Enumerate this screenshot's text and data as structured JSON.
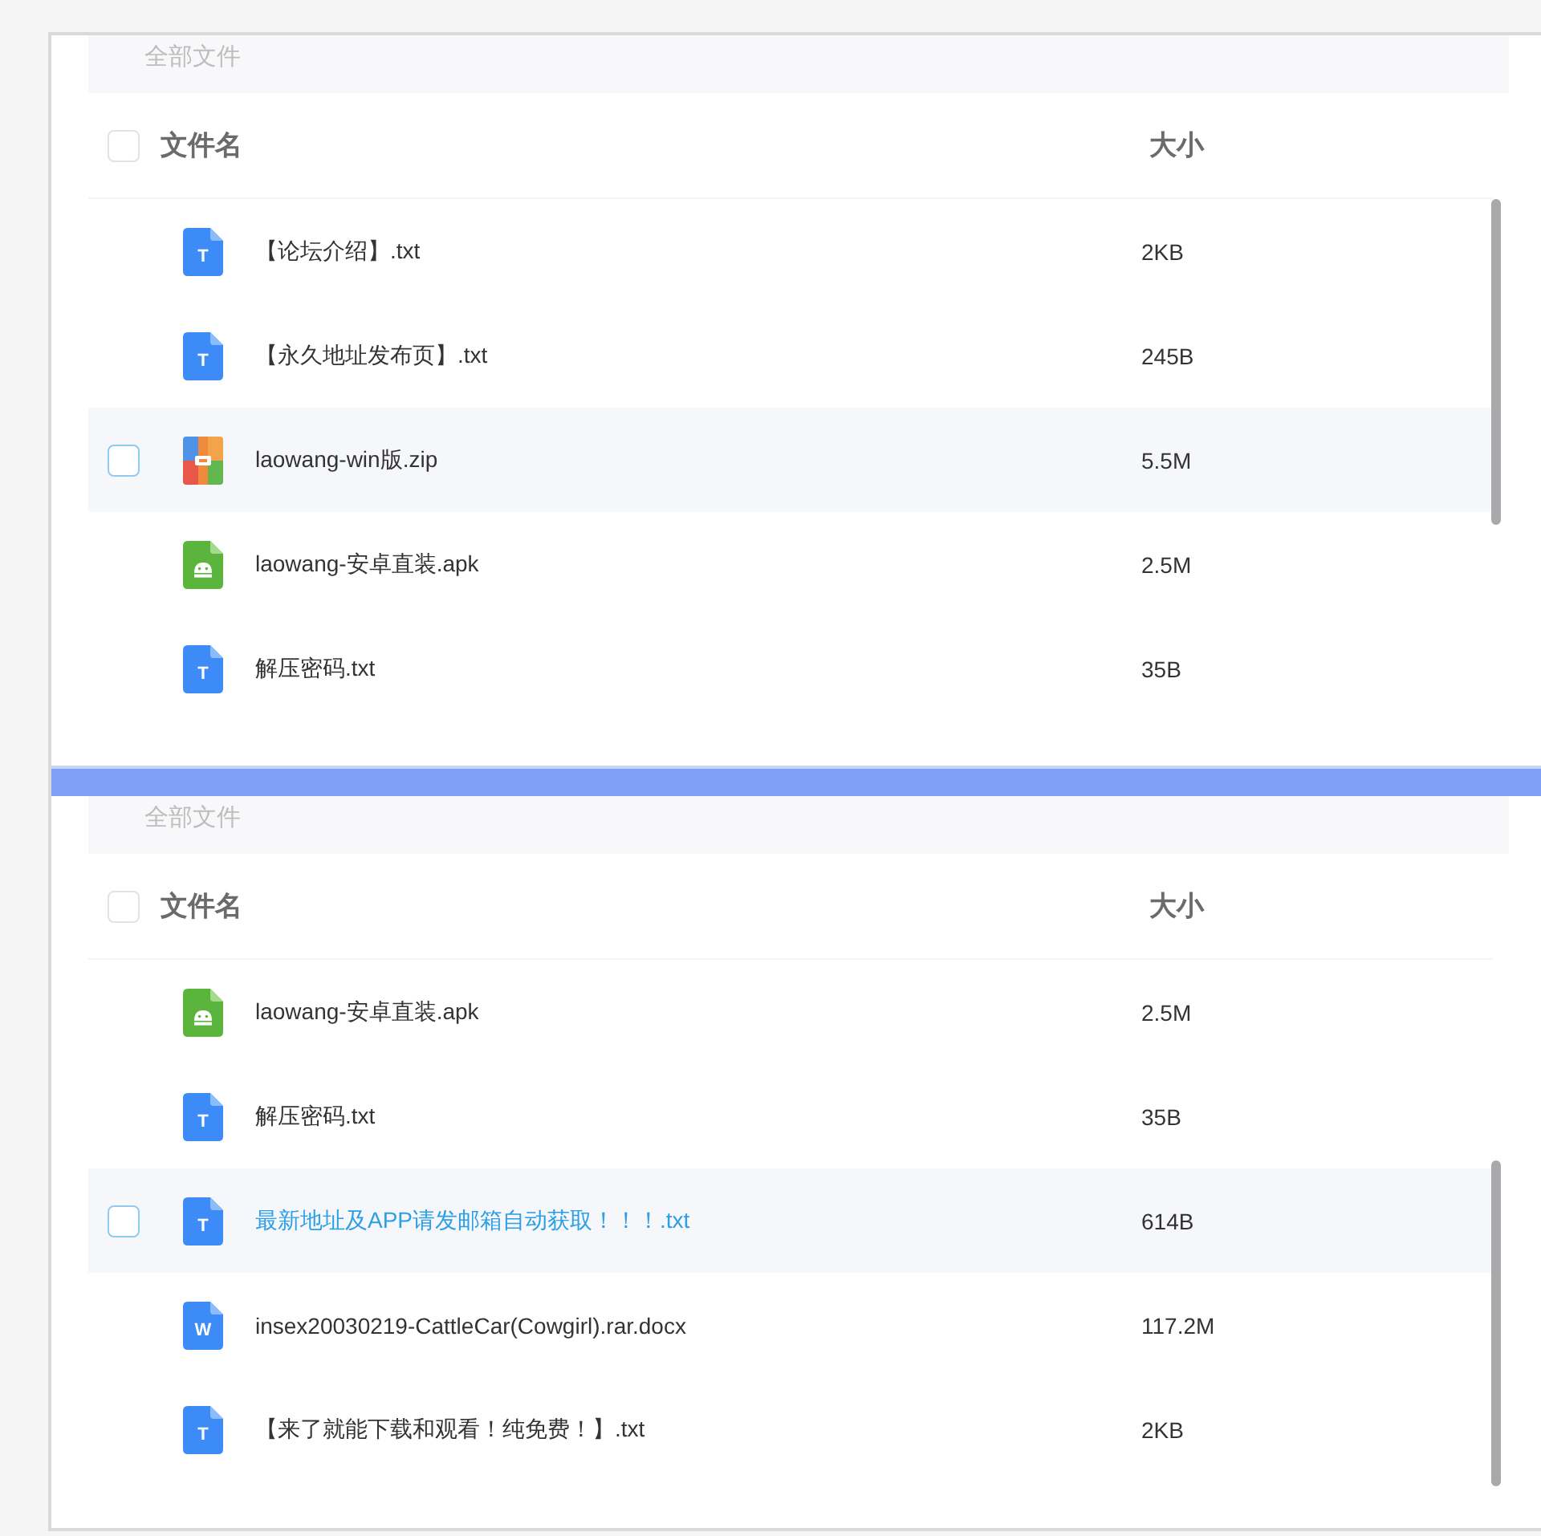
{
  "panels": [
    {
      "kind": "start",
      "breadcrumb": "全部文件",
      "select_all_checked": false,
      "columns": [
        "文件名",
        "大小"
      ],
      "rows": [
        {
          "kind": "txt",
          "icon_letter": "T",
          "name": "【论坛介绍】.txt",
          "size": "2KB",
          "hovered": false,
          "name_highlighted": false
        },
        {
          "kind": "txt",
          "icon_letter": "T",
          "name": "【永久地址发布页】.txt",
          "size": "245B",
          "hovered": false,
          "name_highlighted": false
        },
        {
          "kind": "zip",
          "name": "laowang-win版.zip",
          "size": "5.5M",
          "hovered": true,
          "name_highlighted": false
        },
        {
          "kind": "apk",
          "name": "laowang-安卓直装.apk",
          "size": "2.5M",
          "hovered": false,
          "name_highlighted": false
        },
        {
          "kind": "txt",
          "icon_letter": "T",
          "name": "解压密码.txt",
          "size": "35B",
          "hovered": false,
          "name_highlighted": false
        }
      ]
    },
    {
      "kind": "end",
      "breadcrumb": "全部文件",
      "select_all_checked": false,
      "columns": [
        "文件名",
        "大小"
      ],
      "rows": [
        {
          "kind": "apk",
          "name": "laowang-安卓直装.apk",
          "size": "2.5M",
          "hovered": false,
          "name_highlighted": false
        },
        {
          "kind": "txt",
          "icon_letter": "T",
          "name": "解压密码.txt",
          "size": "35B",
          "hovered": false,
          "name_highlighted": false
        },
        {
          "kind": "txt",
          "icon_letter": "T",
          "name": "最新地址及APP请发邮箱自动获取！！！.txt",
          "size": "614B",
          "hovered": true,
          "name_highlighted": true
        },
        {
          "kind": "doc",
          "icon_letter": "W",
          "name": "insex20030219-CattleCar(Cowgirl).rar.docx",
          "size": "117.2M",
          "hovered": false,
          "name_highlighted": false
        },
        {
          "kind": "txt",
          "icon_letter": "T",
          "name": "【来了就能下载和观看！纯免费！】.txt",
          "size": "2KB",
          "hovered": false,
          "name_highlighted": false
        }
      ]
    }
  ]
}
